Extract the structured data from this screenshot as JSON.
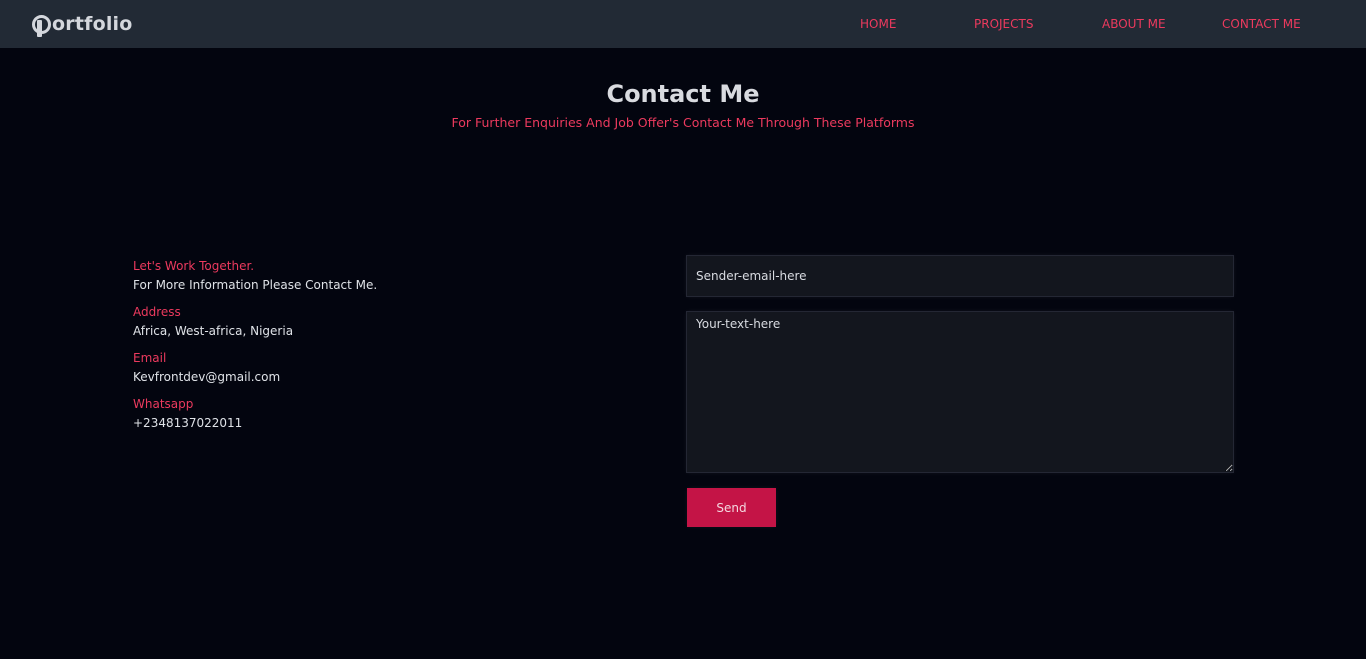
{
  "nav": {
    "logo_text": "ortfolio",
    "links": [
      "HOME",
      "PROJECTS",
      "ABOUT ME",
      "CONTACT ME"
    ]
  },
  "hero": {
    "title": "Contact Me",
    "subtitle": "For Further Enquiries And Job Offer's Contact Me Through These Platforms"
  },
  "contact_info": {
    "intro_label": "Let's Work Together.",
    "intro_text": "For More Information Please Contact Me.",
    "address_label": "Address",
    "address_value": "Africa, West-africa, Nigeria",
    "email_label": "Email",
    "email_value": "Kevfrontdev@gmail.com",
    "whatsapp_label": "Whatsapp",
    "whatsapp_value": "+2348137022011"
  },
  "form": {
    "email_placeholder": "Sender-email-here",
    "message_placeholder": "Your-text-here",
    "send_label": "Send"
  },
  "colors": {
    "accent": "#ec3a5e",
    "button": "#c41446",
    "background": "#03050f",
    "navbar": "#222a35"
  },
  "icons": {
    "logo": "portfolio-p-logo-icon"
  }
}
